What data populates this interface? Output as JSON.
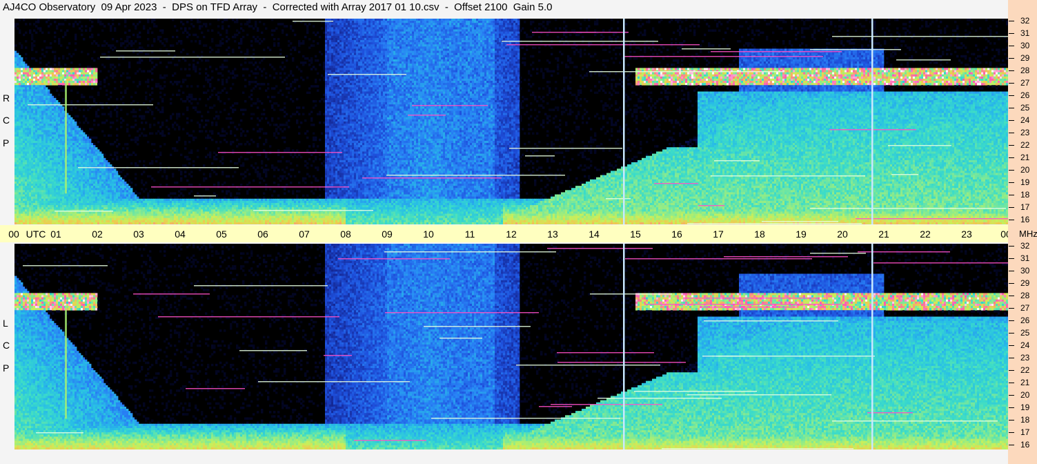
{
  "title": "AJ4CO Observatory  09 Apr 2023  -  DPS on TFD Array  -  Corrected with Array 2017 01 10.csv  -  Offset 2100  Gain 5.0",
  "time_labels": [
    "00",
    "01",
    "02",
    "03",
    "04",
    "05",
    "06",
    "07",
    "08",
    "09",
    "10",
    "11",
    "12",
    "13",
    "14",
    "15",
    "16",
    "17",
    "18",
    "19",
    "20",
    "21",
    "22",
    "23",
    "00"
  ],
  "time_unit": "UTC",
  "freq_unit": "MHz",
  "freq_labels": [
    "32",
    "31",
    "30",
    "29",
    "28",
    "27",
    "26",
    "25",
    "24",
    "23",
    "22",
    "21",
    "20",
    "19",
    "18",
    "17",
    "16"
  ],
  "top_label": [
    "R",
    "C",
    "P"
  ],
  "bottom_label": [
    "L",
    "C",
    "P"
  ],
  "colors": {
    "background": "#000000",
    "deep_blue": "#1a3aa8",
    "mid_blue": "#2a7ef0",
    "cyan": "#30c8d8",
    "green_yellow": "#b8e860",
    "magenta": "#ff40c0",
    "white_line": "#ffffff",
    "axis_bg": "#ffffc0",
    "freq_bg": "#fcd9bd"
  },
  "chart_data": [
    {
      "type": "heatmap",
      "title": "AJ4CO Observatory  09 Apr 2023  -  DPS on TFD Array  -  Corrected with Array 2017 01 10.csv  -  Offset 2100  Gain 5.0",
      "panel": "RCP",
      "x_label": "UTC",
      "y_label": "MHz",
      "x_range": [
        0,
        24
      ],
      "y_range": [
        16,
        32
      ],
      "grid": false
    },
    {
      "type": "heatmap",
      "panel": "LCP",
      "x_label": "UTC",
      "y_label": "MHz",
      "x_range": [
        0,
        24
      ],
      "y_range": [
        16,
        32
      ],
      "grid": false
    }
  ]
}
